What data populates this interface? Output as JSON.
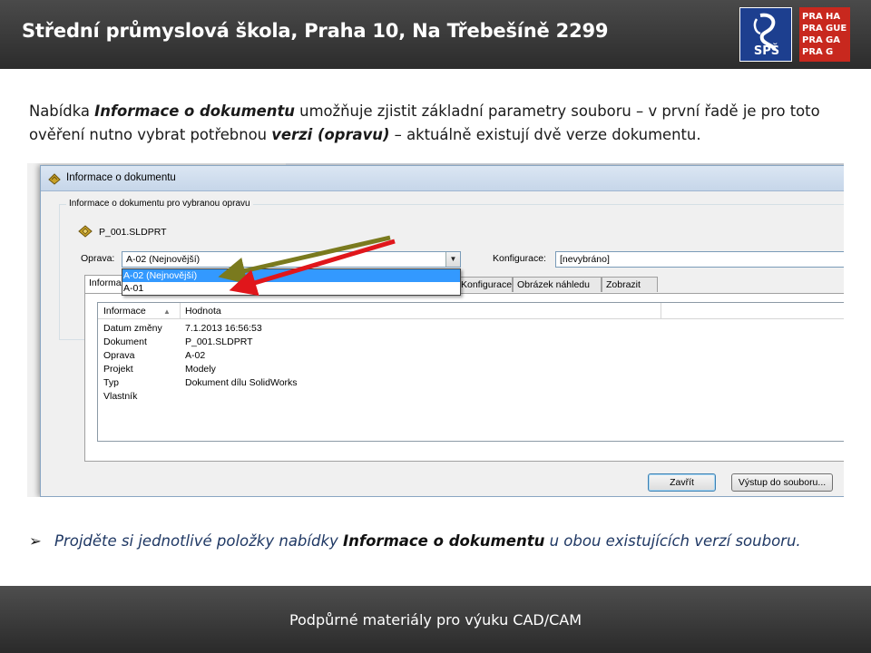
{
  "header": {
    "title": "Střední průmyslová škola, Praha 10, Na Třebešíně 2299",
    "logo_sps_text": "SPŠ",
    "logo_praha": [
      "PRA",
      "HA",
      "PRA",
      "GUE",
      "PRA",
      "GA",
      "PRA",
      "G"
    ]
  },
  "intro": {
    "part1": "Nabídka ",
    "em1": "Informace o dokumentu",
    "part2": " umožňuje zjistit základní parametry souboru – v první řadě je pro toto ověření nutno vybrat potřebnou ",
    "em2": "verzi (opravu)",
    "part3": " – aktuálně existují dvě verze dokumentu."
  },
  "dialog": {
    "title": "Informace o dokumentu",
    "group_label": "Informace o dokumentu pro vybranou opravu",
    "part_name": "P_001.SLDPRT",
    "revision_label": "Oprava:",
    "revision_value": "A-02 (Nejnovější)",
    "revision_options": [
      "A-02 (Nejnovější)",
      "A-01"
    ],
    "config_label": "Konfigurace:",
    "config_value": "[nevybráno]",
    "tabs": [
      "Informace",
      "Konfigurace",
      "Obrázek náhledu",
      "Zobrazit"
    ],
    "columns": [
      "Informace",
      "Hodnota"
    ],
    "rows": [
      {
        "key": "Datum změny",
        "value": "7.1.2013 16:56:53"
      },
      {
        "key": "Dokument",
        "value": "P_001.SLDPRT"
      },
      {
        "key": "Oprava",
        "value": "A-02"
      },
      {
        "key": "Projekt",
        "value": "Modely"
      },
      {
        "key": "Typ",
        "value": "Dokument dílu SolidWorks"
      },
      {
        "key": "Vlastník",
        "value": ""
      }
    ],
    "close_button": "Zavřít",
    "export_button": "Výstup do souboru..."
  },
  "bullet": {
    "part1": "Projděte si jednotlivé položky nabídky ",
    "em": "Informace o dokumentu",
    "part2": " u obou existujících verzí souboru."
  },
  "footer": {
    "text": "Podpůrné materiály pro výuku CAD/CAM"
  },
  "colors": {
    "arrow_olive": "#7a7a1e",
    "arrow_red": "#e0161b",
    "selection": "#3399ff"
  }
}
